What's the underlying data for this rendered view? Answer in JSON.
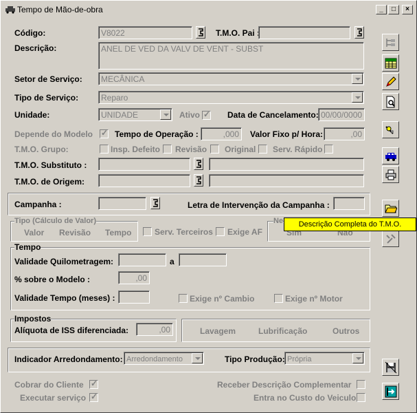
{
  "window": {
    "title": "Tempo de Mão-de-obra",
    "min_label": "_",
    "max_label": "□",
    "close_label": "×"
  },
  "fields": {
    "codigo_label": "Código:",
    "codigo_value": "V8022",
    "tmo_pai_label": "T.M.O. Pai :",
    "tmo_pai_value": "",
    "descricao_label": "Descrição:",
    "descricao_value": "ANEL DE VED DA VALV DE VENT - SUBST",
    "setor_label": "Setor de Serviço:",
    "setor_value": "MECÂNICA",
    "tipo_label": "Tipo de Serviço:",
    "tipo_value": "Reparo",
    "unidade_label": "Unidade:",
    "unidade_value": "UNIDADE",
    "ativo_label": "Ativo",
    "data_cancel_label": "Data de Cancelamento:",
    "data_cancel_value": "00/00/0000",
    "depende_label": "Depende do Modelo",
    "tempo_op_label": "Tempo de Operação :",
    "tempo_op_value": ",000",
    "valor_fixo_label": "Valor Fixo p/ Hora:",
    "valor_fixo_value": ",00",
    "tmo_grupo_label": "T.M.O. Grupo:",
    "insp_defeito_label": "Insp. Defeito",
    "revisao_label": "Revisão",
    "original_label": "Original",
    "serv_rapido_label": "Serv. Rápido",
    "tmo_substituto_label": "T.M.O. Substituto :",
    "tmo_origem_label": "T.M.O. de Origem:",
    "campanha_label": "Campanha :",
    "letra_label": "Letra de Intervenção da Campanha :"
  },
  "calc_group": {
    "title": "Tipo (Cálculo de Valor)",
    "valor": "Valor",
    "revisao": "Revisão",
    "tempo": "Tempo",
    "serv_terceiros": "Serv. Terceiros",
    "exige_af": "Exige AF",
    "ne_title": "Ne",
    "sim": "Sim",
    "nao": "Não"
  },
  "tempo_group": {
    "title": "Tempo",
    "validade_km_label": "Validade Quilometragem:",
    "a_label": "a",
    "sobre_modelo_label": "% sobre o Modelo :",
    "sobre_modelo_value": ",00",
    "validade_tempo_label": "Validade Tempo (meses) :",
    "exige_cambio": "Exige nº Cambio",
    "exige_motor": "Exige nº Motor"
  },
  "impostos_group": {
    "title": "Impostos",
    "aliquota_label": "Alíquota de ISS diferenciada:",
    "aliquota_value": ",00",
    "lavagem": "Lavagem",
    "lubrificacao": "Lubrificação",
    "outros": "Outros"
  },
  "footer": {
    "indicador_label": "Indicador Arredondamento:",
    "indicador_value": "Arredondamento",
    "tipo_producao_label": "Tipo Produção:",
    "tipo_producao_value": "Própria",
    "cobrar_label": "Cobrar do Cliente",
    "executar_label": "Executar serviço",
    "receber_label": "Receber Descrição Complementar",
    "entra_custo_label": "Entra no Custo do Veiculo"
  },
  "tooltip": "Descrição Completa do T.M.O."
}
